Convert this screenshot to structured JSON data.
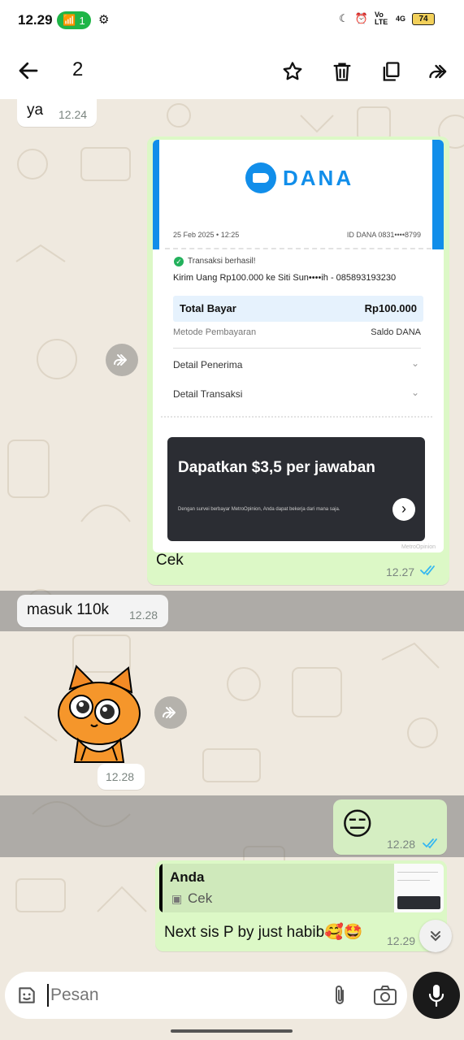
{
  "status_bar": {
    "time": "12.29",
    "hotspot_count": "1",
    "network_labels": "Vo LTE",
    "network_type": "4G",
    "battery": "74"
  },
  "toolbar": {
    "selected_count": "2",
    "icons": [
      "back-arrow-icon",
      "star-icon",
      "delete-icon",
      "copy-icon",
      "forward-icon"
    ]
  },
  "messages": {
    "m1": {
      "text": "ya",
      "time": "12.24"
    },
    "m2": {
      "caption": "Cek",
      "time": "12.27",
      "receipt": {
        "brand": "DANA",
        "date": "25 Feb 2025 • 12:25",
        "id": "ID DANA 0831••••8799",
        "success": "Transaksi berhasil!",
        "transfer": "Kirim Uang Rp100.000 ke Siti Sun••••ih - 085893193230",
        "total_label": "Total Bayar",
        "total_value": "Rp100.000",
        "method_label": "Metode Pembayaran",
        "method_value": "Saldo DANA",
        "detail_recipient": "Detail Penerima",
        "detail_tx": "Detail Transaksi",
        "ad_title": "Dapatkan $3,5 per jawaban",
        "ad_sub": "Dengan survei berbayar MetroOpinion, Anda dapat bekerja dari mana saja.",
        "ad_brand": "MetroOpinion"
      }
    },
    "m3": {
      "text": "masuk 110k",
      "time": "12.28"
    },
    "m4": {
      "time": "12.28"
    },
    "m5": {
      "emoji": "😑",
      "time": "12.28"
    },
    "m6": {
      "reply_author": "Anda",
      "reply_text": "Cek",
      "text": "Next sis P by just habib🥰🤩",
      "time": "12.29"
    }
  },
  "input": {
    "placeholder": "Pesan"
  },
  "colors": {
    "accent": "#1aa34a",
    "tick": "#34b7f1",
    "dana_blue": "#118EEA"
  }
}
